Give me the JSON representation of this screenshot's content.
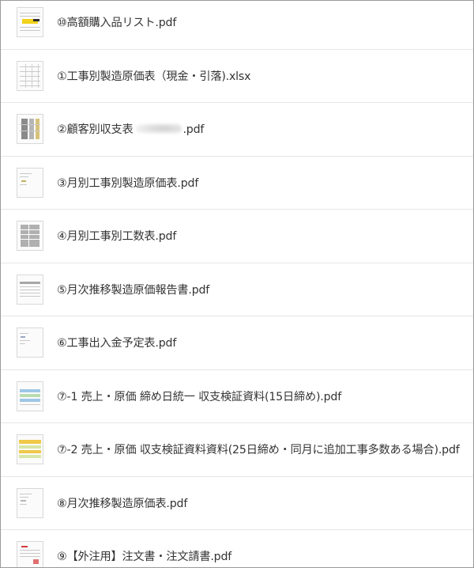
{
  "files": [
    {
      "name": "⑩高額購入品リスト.pdf",
      "thumb": "yellow-highlight-doc"
    },
    {
      "name": "①工事別製造原価表（現金・引落).xlsx",
      "thumb": "spreadsheet-grid"
    },
    {
      "name_prefix": "②顧客別収支表",
      "name_suffix": ".pdf",
      "thumb": "dark-table"
    },
    {
      "name": "③月別工事別製造原価表.pdf",
      "thumb": "sparse-doc"
    },
    {
      "name": "④月別工事別工数表.pdf",
      "thumb": "dark-grid"
    },
    {
      "name": "⑤月次推移製造原価報告書.pdf",
      "thumb": "wide-table"
    },
    {
      "name": "⑥工事出入金予定表.pdf",
      "thumb": "sparse-doc"
    },
    {
      "name": "⑦-1 売上・原価 締め日統一 収支検証資料(15日締め).pdf",
      "thumb": "blue-green-table"
    },
    {
      "name": "⑦-2 売上・原価 収支検証資料資料(25日締め・同月に追加工事多数ある場合).pdf",
      "thumb": "yellow-green-table"
    },
    {
      "name": "⑧月次推移製造原価表.pdf",
      "thumb": "sparse-doc"
    },
    {
      "name": "⑨【外注用】注文書・注文請書.pdf",
      "thumb": "red-form"
    }
  ]
}
